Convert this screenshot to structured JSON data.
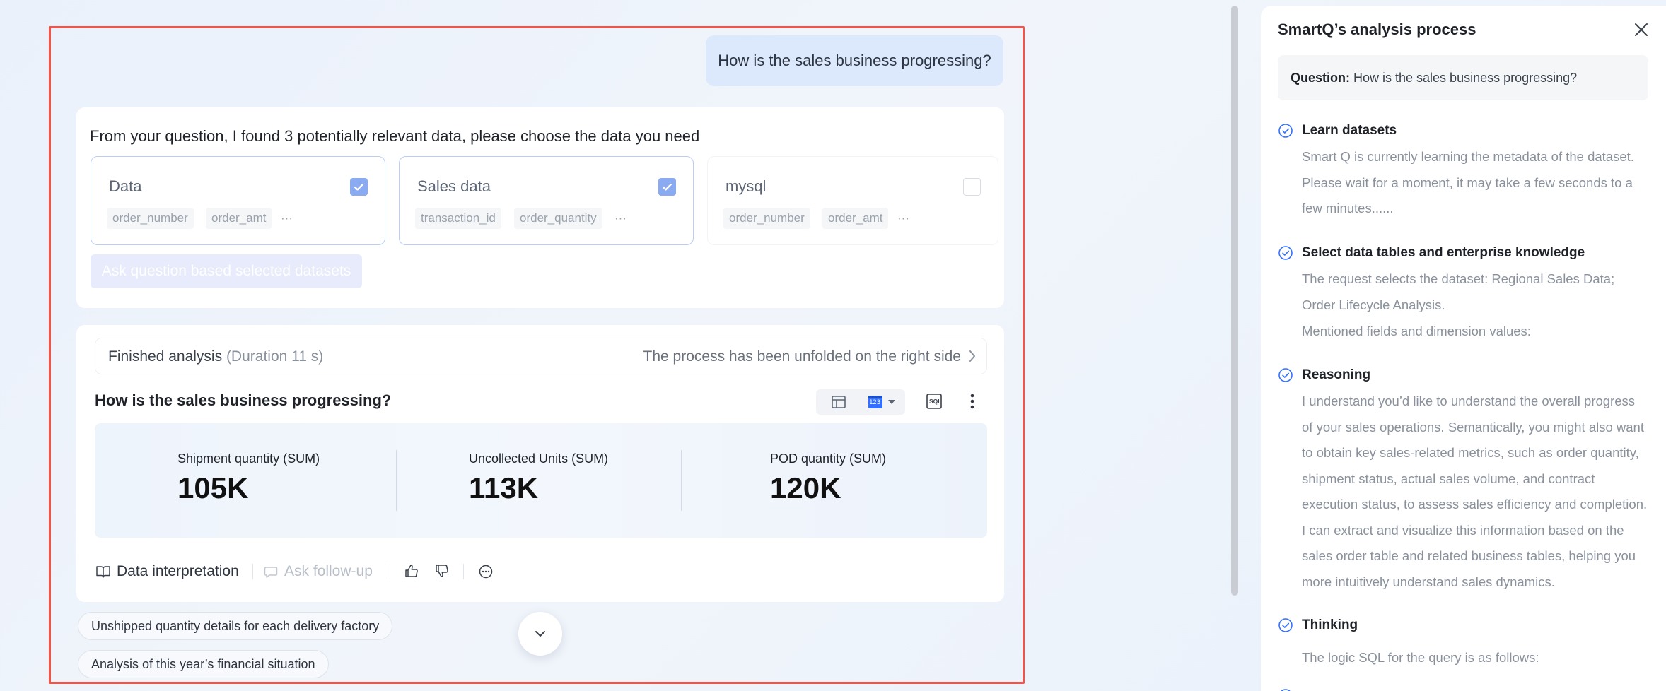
{
  "chat": {
    "user_question": "How is the sales business progressing?",
    "dataset_intro": "From your question, I found 3 potentially relevant data, please choose the data you need",
    "datasets": [
      {
        "name": "Data",
        "tags": [
          "order_number",
          "order_amt"
        ],
        "more": "···",
        "selected": true
      },
      {
        "name": "Sales data",
        "tags": [
          "transaction_id",
          "order_quantity"
        ],
        "more": "···",
        "selected": true
      },
      {
        "name": "mysql",
        "tags": [
          "order_number",
          "order_amt"
        ],
        "more": "···",
        "selected": false
      }
    ],
    "ask_button": "Ask question based selected datasets"
  },
  "analysis": {
    "status": "Finished analysis",
    "duration": "(Duration 11 s)",
    "unfold_note": "The process has been unfolded on the right side",
    "title": "How is the sales business progressing?",
    "kpis": [
      {
        "label": "Shipment quantity (SUM)",
        "value": "105K"
      },
      {
        "label": "Uncollected Units (SUM)",
        "value": "113K"
      },
      {
        "label": "POD quantity (SUM)",
        "value": "120K"
      }
    ],
    "actions": {
      "interpret": "Data interpretation",
      "follow_up": "Ask follow-up"
    },
    "sql_icon_text": "SQL",
    "chart_icon_text": "123"
  },
  "suggestions": [
    "Unshipped quantity details for each delivery factory",
    "Analysis of this year’s financial situation"
  ],
  "panel": {
    "title": "SmartQ’s analysis process",
    "question_label": "Question:",
    "question": "How is the sales business progressing?",
    "steps": [
      {
        "title": "Learn datasets",
        "body": "Smart Q is currently learning the metadata of the dataset. Please wait for a moment, it may take a few seconds to a few minutes......"
      },
      {
        "title": "Select data tables and enterprise knowledge",
        "body": "The request selects the dataset: Regional Sales Data; Order Lifecycle Analysis.",
        "extra": "Mentioned fields and dimension values:"
      },
      {
        "title": "Reasoning",
        "body": "I understand you’d like to understand the overall progress of your sales operations. Semantically, you might also want to obtain key sales-related metrics, such as order quantity, shipment status, actual sales volume, and contract execution status, to assess sales efficiency and completion. I can extract and visualize this information based on the sales order table and related business tables, helping you more intuitively understand sales dynamics."
      },
      {
        "title": "Thinking",
        "body": "The logic SQL for the query is as follows:"
      }
    ]
  },
  "colors": {
    "accent": "#3370ff",
    "frame": "#f0554b",
    "bubble": "#dce8fb"
  }
}
